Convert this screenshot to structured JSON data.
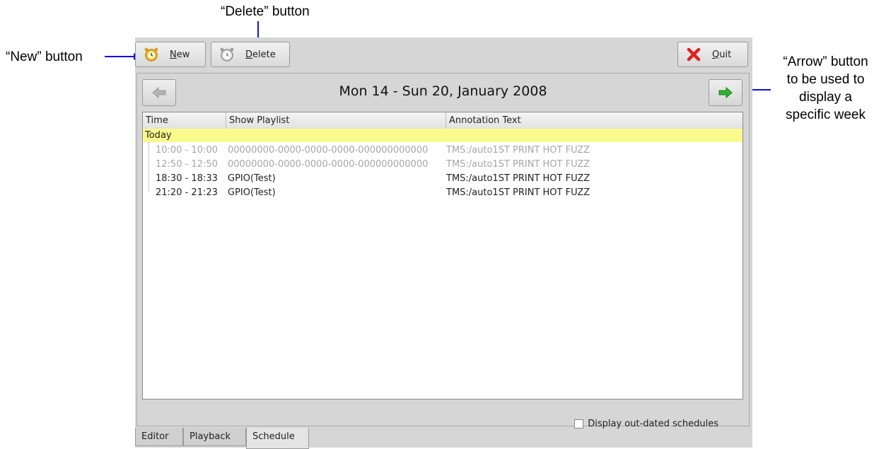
{
  "annotations": {
    "delete": "“Delete” button",
    "new": "“New” button",
    "arrow_lines": [
      "“Arrow” button",
      "to be used to",
      "display a",
      "specific week"
    ]
  },
  "toolbar": {
    "new_label": "New",
    "delete_label": "Delete",
    "quit_label": "Quit"
  },
  "week": {
    "title": "Mon 14 - Sun 20, January 2008"
  },
  "table": {
    "columns": [
      "Time",
      "Show Playlist",
      "Annotation Text"
    ],
    "group_label": "Today",
    "rows": [
      {
        "time": "10:00 - 10:00",
        "playlist": "00000000-0000-0000-0000-000000000000",
        "annotation": "TMS:/auto1ST PRINT HOT FUZZ"
      },
      {
        "time": "12:50 - 12:50",
        "playlist": "00000000-0000-0000-0000-000000000000",
        "annotation": "TMS:/auto1ST PRINT HOT FUZZ"
      },
      {
        "time": "18:30 - 18:33",
        "playlist": "GPIO(Test)",
        "annotation": "TMS:/auto1ST PRINT HOT FUZZ"
      },
      {
        "time": "21:20 - 21:23",
        "playlist": "GPIO(Test)",
        "annotation": "TMS:/auto1ST PRINT HOT FUZZ"
      }
    ]
  },
  "options": {
    "outdated_label": "Display out-dated schedules",
    "outdated_checked": false
  },
  "tabs": [
    "Editor",
    "Playback",
    "Schedule"
  ],
  "colors": {
    "today_highlight": "#fafa8c",
    "annotation_arrow": "#1010e0",
    "next_arrow": "#2fb52f"
  }
}
